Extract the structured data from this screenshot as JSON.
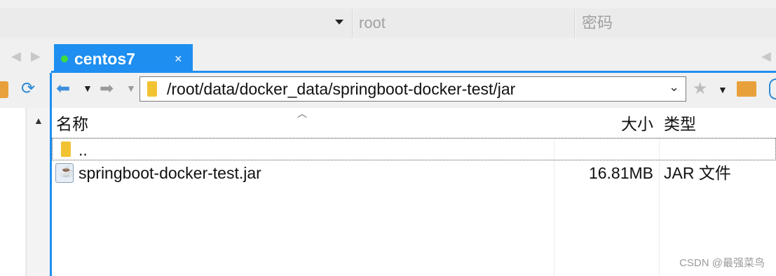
{
  "login": {
    "user_placeholder": "root",
    "password_placeholder": "密码"
  },
  "tabs": [
    {
      "label": "centos7",
      "close": "×",
      "status_color": "#3fdc3f"
    }
  ],
  "toolbar": {
    "path": "/root/data/docker_data/springboot-docker-test/jar"
  },
  "file_list": {
    "columns": {
      "name": "名称",
      "size": "大小",
      "type": "类型"
    },
    "rows": [
      {
        "name": "..",
        "size": "",
        "type": "",
        "icon": "folder-icon"
      },
      {
        "name": "springboot-docker-test.jar",
        "size": "16.81MB",
        "type": "JAR 文件",
        "icon": "java-jar-icon"
      }
    ]
  },
  "watermark": "CSDN @最强菜鸟",
  "colors": {
    "accent": "#1e8ff0",
    "folder": "#f1c232"
  }
}
